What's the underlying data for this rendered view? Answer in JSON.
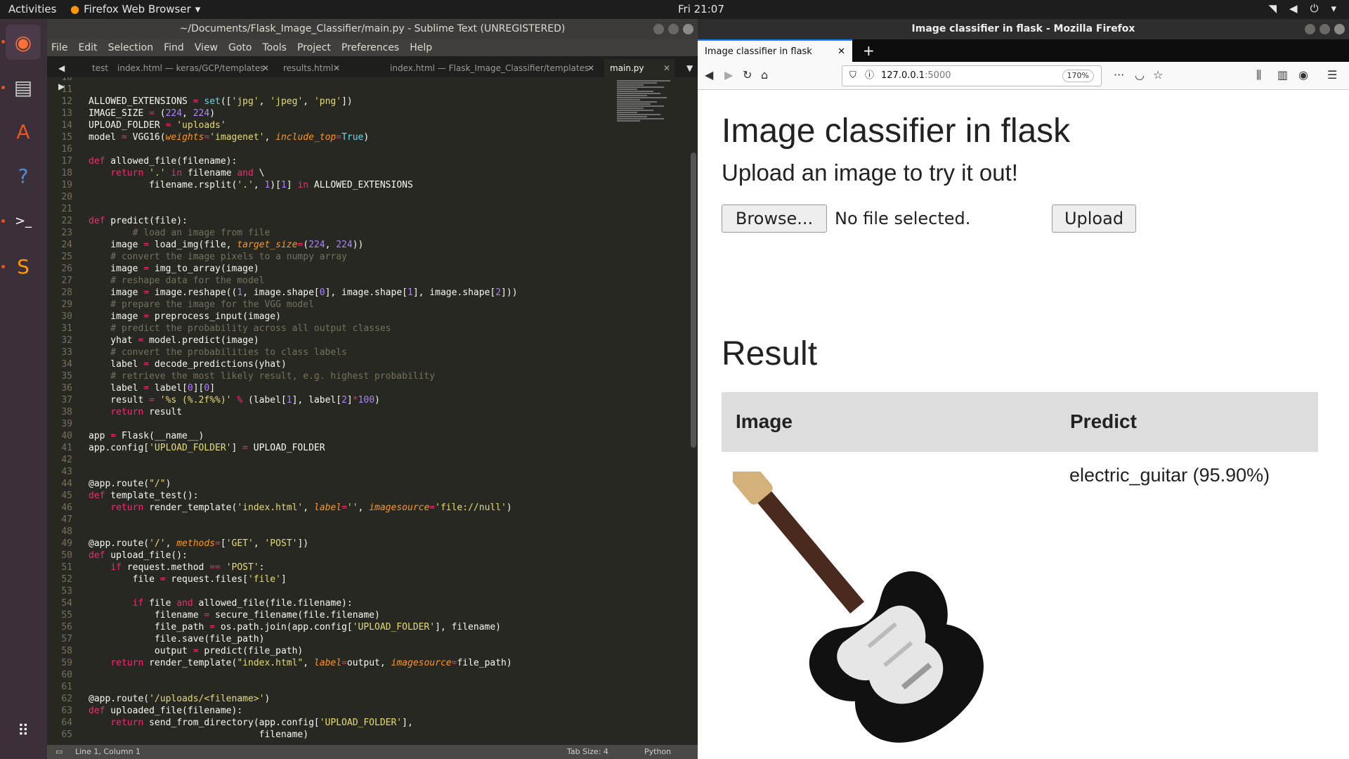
{
  "topbar": {
    "activities": "Activities",
    "app": "Firefox Web Browser",
    "clock": "Fri 21:07"
  },
  "sublime": {
    "title": "~/Documents/Flask_Image_Classifier/main.py - Sublime Text (UNREGISTERED)",
    "menu": [
      "File",
      "Edit",
      "Selection",
      "Find",
      "View",
      "Goto",
      "Tools",
      "Project",
      "Preferences",
      "Help"
    ],
    "tabs": [
      "test",
      "index.html — keras/GCP/templates",
      "results.html",
      "index.html — Flask_Image_Classifier/templates",
      "main.py"
    ],
    "status": {
      "position": "Line 1, Column 1",
      "tab_size": "Tab Size: 4",
      "syntax": "Python"
    },
    "first_line": 10,
    "lines": [
      "",
      "",
      "ALLOWED_EXTENSIONS = set(['jpg', 'jpeg', 'png'])",
      "IMAGE_SIZE = (224, 224)",
      "UPLOAD_FOLDER = 'uploads'",
      "model = VGG16(weights='imagenet', include_top=True)",
      "",
      "def allowed_file(filename):",
      "    return '.' in filename and \\",
      "           filename.rsplit('.', 1)[1] in ALLOWED_EXTENSIONS",
      "",
      "",
      "def predict(file):",
      "        # load an image from file",
      "    image = load_img(file, target_size=(224, 224))",
      "    # convert the image pixels to a numpy array",
      "    image = img_to_array(image)",
      "    # reshape data for the model",
      "    image = image.reshape((1, image.shape[0], image.shape[1], image.shape[2]))",
      "    # prepare the image for the VGG model",
      "    image = preprocess_input(image)",
      "    # predict the probability across all output classes",
      "    yhat = model.predict(image)",
      "    # convert the probabilities to class labels",
      "    label = decode_predictions(yhat)",
      "    # retrieve the most likely result, e.g. highest probability",
      "    label = label[0][0]",
      "    result = '%s (%.2f%%)' % (label[1], label[2]*100)",
      "    return result",
      "",
      "app = Flask(__name__)",
      "app.config['UPLOAD_FOLDER'] = UPLOAD_FOLDER",
      "",
      "",
      "@app.route(\"/\")",
      "def template_test():",
      "    return render_template('index.html', label='', imagesource='file://null')",
      "",
      "",
      "@app.route('/', methods=['GET', 'POST'])",
      "def upload_file():",
      "    if request.method == 'POST':",
      "        file = request.files['file']",
      "",
      "        if file and allowed_file(file.filename):",
      "            filename = secure_filename(file.filename)",
      "            file_path = os.path.join(app.config['UPLOAD_FOLDER'], filename)",
      "            file.save(file_path)",
      "            output = predict(file_path)",
      "    return render_template(\"index.html\", label=output, imagesource=file_path)",
      "",
      "",
      "@app.route('/uploads/<filename>')",
      "def uploaded_file(filename):",
      "    return send_from_directory(app.config['UPLOAD_FOLDER'],",
      "                               filename)"
    ]
  },
  "firefox": {
    "title": "Image classifier in flask - Mozilla Firefox",
    "tab": "Image classifier in flask",
    "url_host": "127.0.0.1",
    "url_port": ":5000",
    "zoom": "170%",
    "page": {
      "heading": "Image classifier in flask",
      "subheading": "Upload an image to try it out!",
      "browse": "Browse...",
      "nofile": "No file selected.",
      "upload": "Upload",
      "result": "Result",
      "col_image": "Image",
      "col_predict": "Predict",
      "prediction": "electric_guitar (95.90%)"
    }
  }
}
